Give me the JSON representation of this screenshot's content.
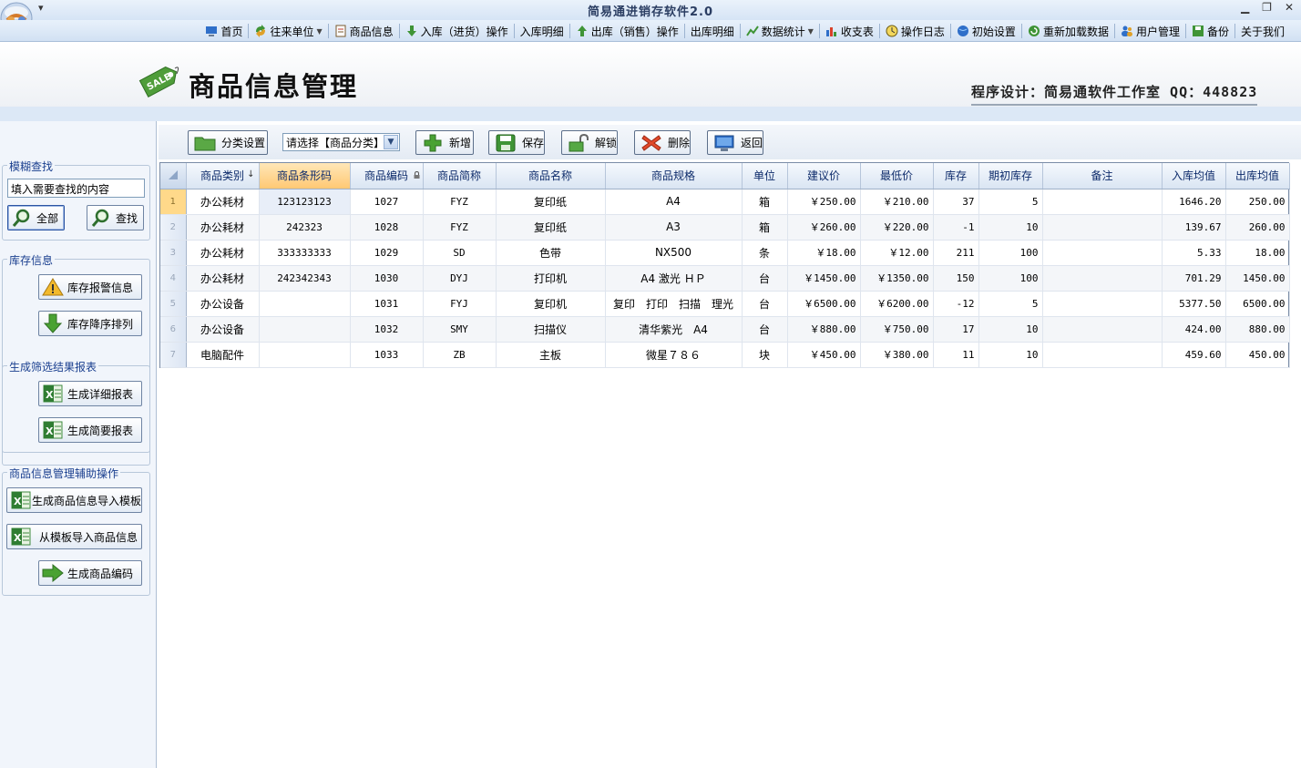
{
  "window": {
    "title": "简易通进销存软件2.0"
  },
  "menu": {
    "items": [
      {
        "label": "首页",
        "icon": "monitor-icon",
        "dropdown": false
      },
      {
        "label": "往来单位",
        "icon": "recycle-icon",
        "dropdown": true
      },
      {
        "label": "商品信息",
        "icon": "document-icon",
        "dropdown": false
      },
      {
        "label": "入库（进货）操作",
        "icon": "arrow-down-icon",
        "dropdown": false
      },
      {
        "label": "入库明细",
        "icon": "none",
        "dropdown": false
      },
      {
        "label": "出库（销售）操作",
        "icon": "arrow-up-icon",
        "dropdown": false
      },
      {
        "label": "出库明细",
        "icon": "none",
        "dropdown": false
      },
      {
        "label": "数据统计",
        "icon": "chart-line-icon",
        "dropdown": true
      },
      {
        "label": "收支表",
        "icon": "bar-chart-icon",
        "dropdown": false
      },
      {
        "label": "操作日志",
        "icon": "clock-icon",
        "dropdown": false
      },
      {
        "label": "初始设置",
        "icon": "globe-icon",
        "dropdown": false
      },
      {
        "label": "重新加载数据",
        "icon": "refresh-icon",
        "dropdown": false
      },
      {
        "label": "用户管理",
        "icon": "users-icon",
        "dropdown": false
      },
      {
        "label": "备份",
        "icon": "save-icon",
        "dropdown": false
      },
      {
        "label": "关于我们",
        "icon": "none",
        "dropdown": false
      }
    ]
  },
  "header": {
    "title": "商品信息管理",
    "tag_text": "SALE",
    "credit": "程序设计：简易通软件工作室 QQ：448823"
  },
  "sidebar": {
    "fuzzy_search": {
      "title": "模糊查找",
      "input_value": "填入需要查找的内容",
      "all_label": "全部",
      "find_label": "查找"
    },
    "stock_info": {
      "title": "库存信息",
      "alert_label": "库存报警信息",
      "desc_label": "库存降序排列"
    },
    "reports": {
      "title": "生成筛选结果报表",
      "detail_label": "生成详细报表",
      "summary_label": "生成简要报表"
    },
    "aux": {
      "title": "商品信息管理辅助操作",
      "template_label": "生成商品信息导入模板",
      "import_label": "从模板导入商品信息",
      "code_label": "生成商品编码"
    }
  },
  "toolbar": {
    "category_label": "分类设置",
    "select_value": "请选择【商品分类】",
    "add_label": "新增",
    "save_label": "保存",
    "unlock_label": "解锁",
    "delete_label": "删除",
    "back_label": "返回"
  },
  "grid": {
    "columns": [
      "商品类别",
      "商品条形码",
      "商品编码",
      "商品简称",
      "商品名称",
      "商品规格",
      "单位",
      "建议价",
      "最低价",
      "库存",
      "期初库存",
      "备注",
      "入库均值",
      "出库均值"
    ],
    "rows": [
      {
        "n": "1",
        "cells": [
          "办公耗材",
          "123123123",
          "1027",
          "FYZ",
          "复印纸",
          "A4",
          "箱",
          "￥250.00",
          "￥210.00",
          "37",
          "5",
          "",
          "1646.20",
          "250.00"
        ]
      },
      {
        "n": "2",
        "cells": [
          "办公耗材",
          "242323",
          "1028",
          "FYZ",
          "复印纸",
          "A3",
          "箱",
          "￥260.00",
          "￥220.00",
          "-1",
          "10",
          "",
          "139.67",
          "260.00"
        ]
      },
      {
        "n": "3",
        "cells": [
          "办公耗材",
          "333333333",
          "1029",
          "SD",
          "色带",
          "NX500",
          "条",
          "￥18.00",
          "￥12.00",
          "211",
          "100",
          "",
          "5.33",
          "18.00"
        ]
      },
      {
        "n": "4",
        "cells": [
          "办公耗材",
          "242342343",
          "1030",
          "DYJ",
          "打印机",
          "A4 激光 ＨＰ",
          "台",
          "￥1450.00",
          "￥1350.00",
          "150",
          "100",
          "",
          "701.29",
          "1450.00"
        ]
      },
      {
        "n": "5",
        "cells": [
          "办公设备",
          "",
          "1031",
          "FYJ",
          "复印机",
          "复印　打印　扫描　理光",
          "台",
          "￥6500.00",
          "￥6200.00",
          "-12",
          "5",
          "",
          "5377.50",
          "6500.00"
        ]
      },
      {
        "n": "6",
        "cells": [
          "办公设备",
          "",
          "1032",
          "SMY",
          "扫描仪",
          "清华紫光　A4",
          "台",
          "￥880.00",
          "￥750.00",
          "17",
          "10",
          "",
          "424.00",
          "880.00"
        ]
      },
      {
        "n": "7",
        "cells": [
          "电脑配件",
          "",
          "1033",
          "ZB",
          "主板",
          "微星７８６",
          "块",
          "￥450.00",
          "￥380.00",
          "11",
          "10",
          "",
          "459.60",
          "450.00"
        ]
      }
    ]
  }
}
